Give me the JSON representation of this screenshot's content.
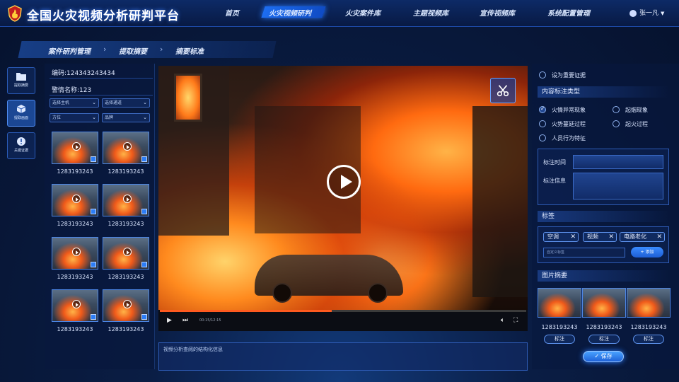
{
  "header": {
    "title": "全国火灾视频分析研判平台",
    "nav": [
      "首页",
      "火灾视频研判",
      "火灾案件库",
      "主题视频库",
      "宣传视频库",
      "系统配置管理"
    ],
    "active_nav": "火灾视频研判",
    "user": "张一凡"
  },
  "breadcrumb": [
    "案件研判管理",
    "提取摘要",
    "摘要标准"
  ],
  "rail": [
    {
      "label": "提取摘要",
      "icon": "folder-icon"
    },
    {
      "label": "提取画面",
      "icon": "cube-icon"
    },
    {
      "label": "关键证据",
      "icon": "alert-icon"
    }
  ],
  "info": {
    "code": "编码:124343243434",
    "case_name": "警情名称:123"
  },
  "filters": [
    "选择主机",
    "选择通道",
    "方位",
    "品牌"
  ],
  "thumbnails": [
    "1283193243",
    "1283193243",
    "1283193243",
    "1283193243",
    "1283193243",
    "1283193243",
    "1283193243",
    "1283193243"
  ],
  "video": {
    "timecode": "00:15/12:15",
    "progress": 0.47
  },
  "description_placeholder": "视频分析查阅的结构化信息",
  "right": {
    "key_evidence": "设为重要证据",
    "annot_type_title": "内容标注类型",
    "annot_types": [
      {
        "label": "火情异常现象",
        "checked": true
      },
      {
        "label": "起烟现象",
        "checked": false
      },
      {
        "label": "火势蔓延过程",
        "checked": false
      },
      {
        "label": "起火过程",
        "checked": false
      },
      {
        "label": "人员行为特征",
        "checked": false
      }
    ],
    "annot_time_label": "标注时间",
    "annot_info_label": "标注信息",
    "tags_title": "标签",
    "tags": [
      "空调",
      "视频",
      "电路老化"
    ],
    "tag_input_placeholder": "自定义标签",
    "add_button": "+ 添加",
    "pics_title": "图片摘要",
    "pics": [
      "1283193243",
      "1283193243",
      "1283193243"
    ],
    "pic_button": "标注",
    "save_button": "✓ 保存"
  }
}
